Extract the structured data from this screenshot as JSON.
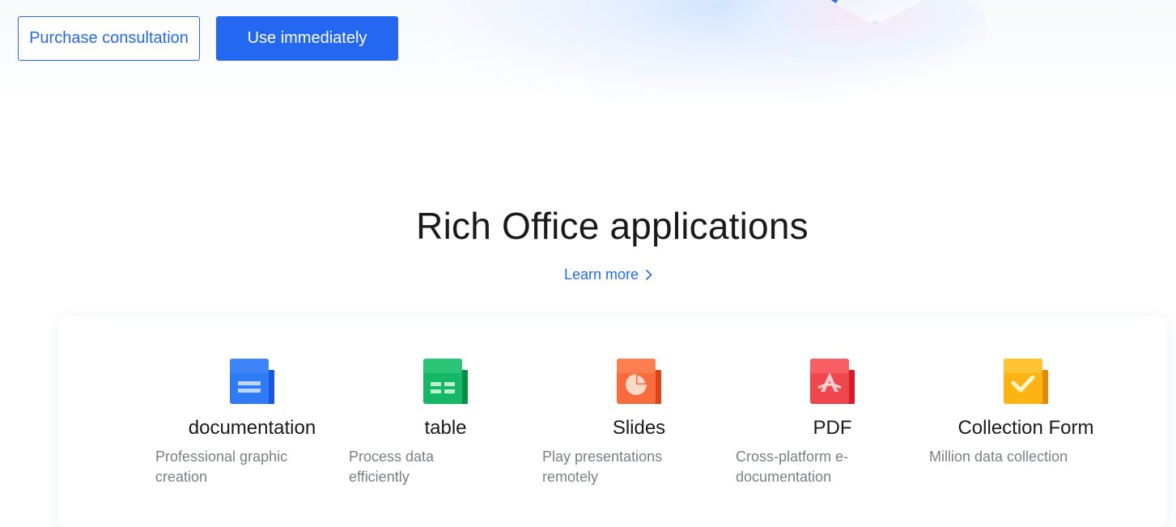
{
  "hero": {
    "purchase_label": "Purchase consultation",
    "use_label": "Use immediately"
  },
  "section": {
    "title": "Rich Office applications",
    "learn_more": "Learn more"
  },
  "apps": [
    {
      "name": "documentation",
      "desc": "Professional graphic creation",
      "icon": "document-icon",
      "color": "#2f7bf5"
    },
    {
      "name": "table",
      "desc": "Process data efficiently",
      "icon": "spreadsheet-icon",
      "color": "#14b866"
    },
    {
      "name": "Slides",
      "desc": "Play presentations remotely",
      "icon": "presentation-icon",
      "color": "#f86b3c"
    },
    {
      "name": "PDF",
      "desc": "Cross-platform e-documentation",
      "icon": "pdf-icon",
      "color": "#f0474f"
    },
    {
      "name": "Collection Form",
      "desc": "Million data collection",
      "icon": "form-check-icon",
      "color": "#fbb411"
    }
  ],
  "colors": {
    "accent": "#2468f2",
    "title": "#1a1a1a",
    "muted": "#7a7f87"
  }
}
